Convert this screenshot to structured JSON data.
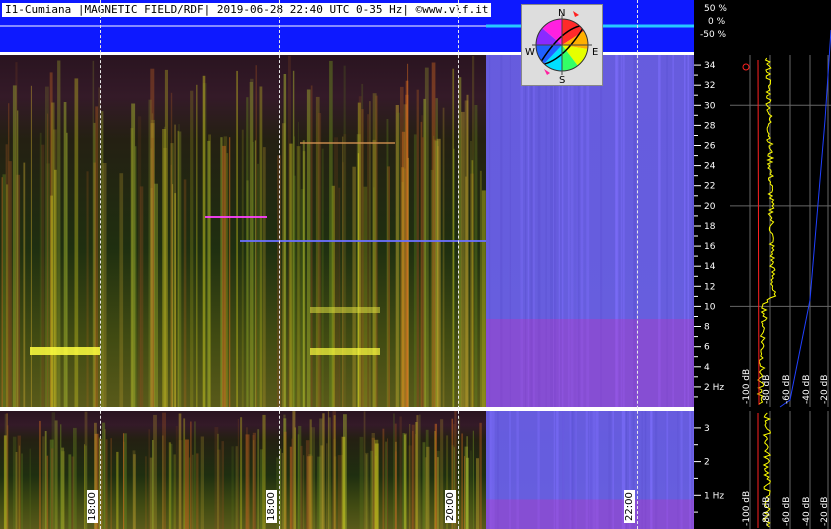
{
  "title": "I1-Cumiana |MAGNETIC FIELD/RDF| 2019-06-28 22:40 UTC 0-35 Hz| ©www.vlf.it",
  "header_scale": [
    "50 %",
    "0 %",
    "-50 %"
  ],
  "compass": {
    "n": "N",
    "s": "S",
    "e": "E",
    "w": "W"
  },
  "chart_data": [
    {
      "type": "heatmap",
      "name_hidden": true,
      "ylabel": "Hz",
      "ylim": [
        0,
        35
      ],
      "y_ticks": [
        "2 Hz",
        "4",
        "6",
        "8",
        "10",
        "12",
        "14",
        "16",
        "18",
        "20",
        "22",
        "24",
        "26",
        "28",
        "30",
        "32",
        "34"
      ],
      "x_ticks": [
        "18:00",
        "18:00",
        "20:00",
        "22:00"
      ],
      "db_ticks": [
        "-100 dB",
        "-80 dB",
        "-60 dB",
        "-40 dB",
        "-20 dB"
      ]
    },
    {
      "type": "heatmap",
      "name_hidden": true,
      "ylim": [
        0,
        3.5
      ],
      "y_ticks": [
        "1 Hz",
        "2",
        "3"
      ],
      "db_ticks": [
        "-100 dB",
        "-80 dB",
        "-60 dB",
        "-40 dB",
        "-20 dB"
      ]
    }
  ],
  "colors": {
    "header": "#0d19ff",
    "spectrum_blue": "#6a5fe6",
    "trace": "#ffff00",
    "trace_red": "#ff2020"
  }
}
